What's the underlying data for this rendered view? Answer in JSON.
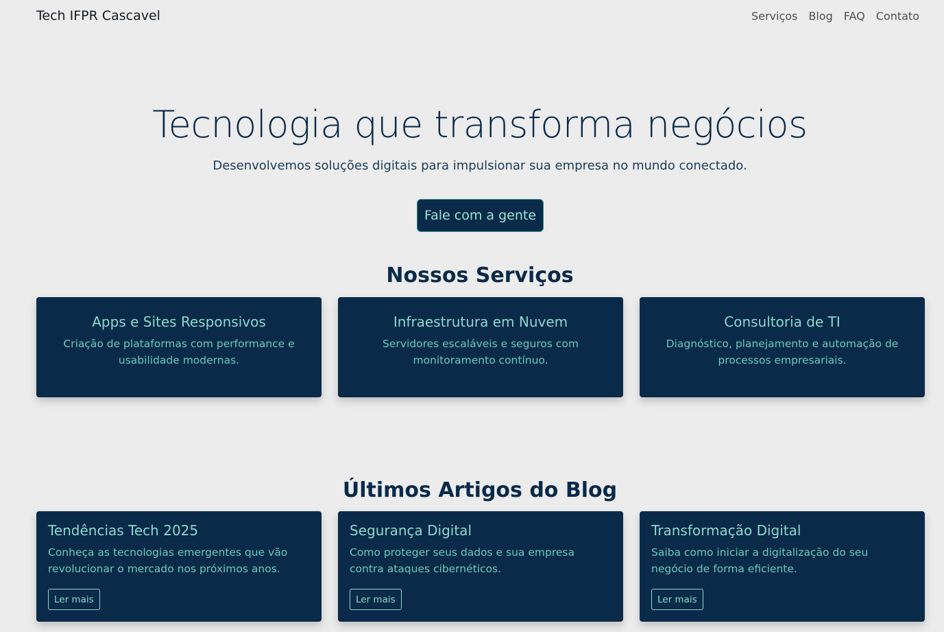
{
  "navbar": {
    "brand": "Tech IFPR Cascavel",
    "links": [
      "Serviços",
      "Blog",
      "FAQ",
      "Contato"
    ]
  },
  "hero": {
    "title": "Tecnologia que transforma negócios",
    "subtitle": "Desenvolvemos soluções digitais para impulsionar sua empresa no mundo conectado.",
    "cta_label": "Fale com a gente"
  },
  "services": {
    "heading": "Nossos Serviços",
    "items": [
      {
        "title": "Apps e Sites Responsivos",
        "description": "Criação de plataformas com performance e usabilidade modernas."
      },
      {
        "title": "Infraestrutura em Nuvem",
        "description": "Servidores escaláveis e seguros com monitoramento contínuo."
      },
      {
        "title": "Consultoria de TI",
        "description": "Diagnóstico, planejamento e automação de processos empresariais."
      }
    ]
  },
  "blog": {
    "heading": "Últimos Artigos do Blog",
    "items": [
      {
        "title": "Tendências Tech 2025",
        "excerpt": "Conheça as tecnologias emergentes que vão revolucionar o mercado nos próximos anos.",
        "button": "Ler mais"
      },
      {
        "title": "Segurança Digital",
        "excerpt": "Como proteger seus dados e sua empresa contra ataques cibernéticos.",
        "button": "Ler mais"
      },
      {
        "title": "Transformação Digital",
        "excerpt": "Saiba como iniciar a digitalização do seu negócio de forma eficiente.",
        "button": "Ler mais"
      }
    ]
  },
  "colors": {
    "background": "#ececec",
    "primary_dark": "#0a2a49",
    "accent": "#8fd8cc"
  }
}
